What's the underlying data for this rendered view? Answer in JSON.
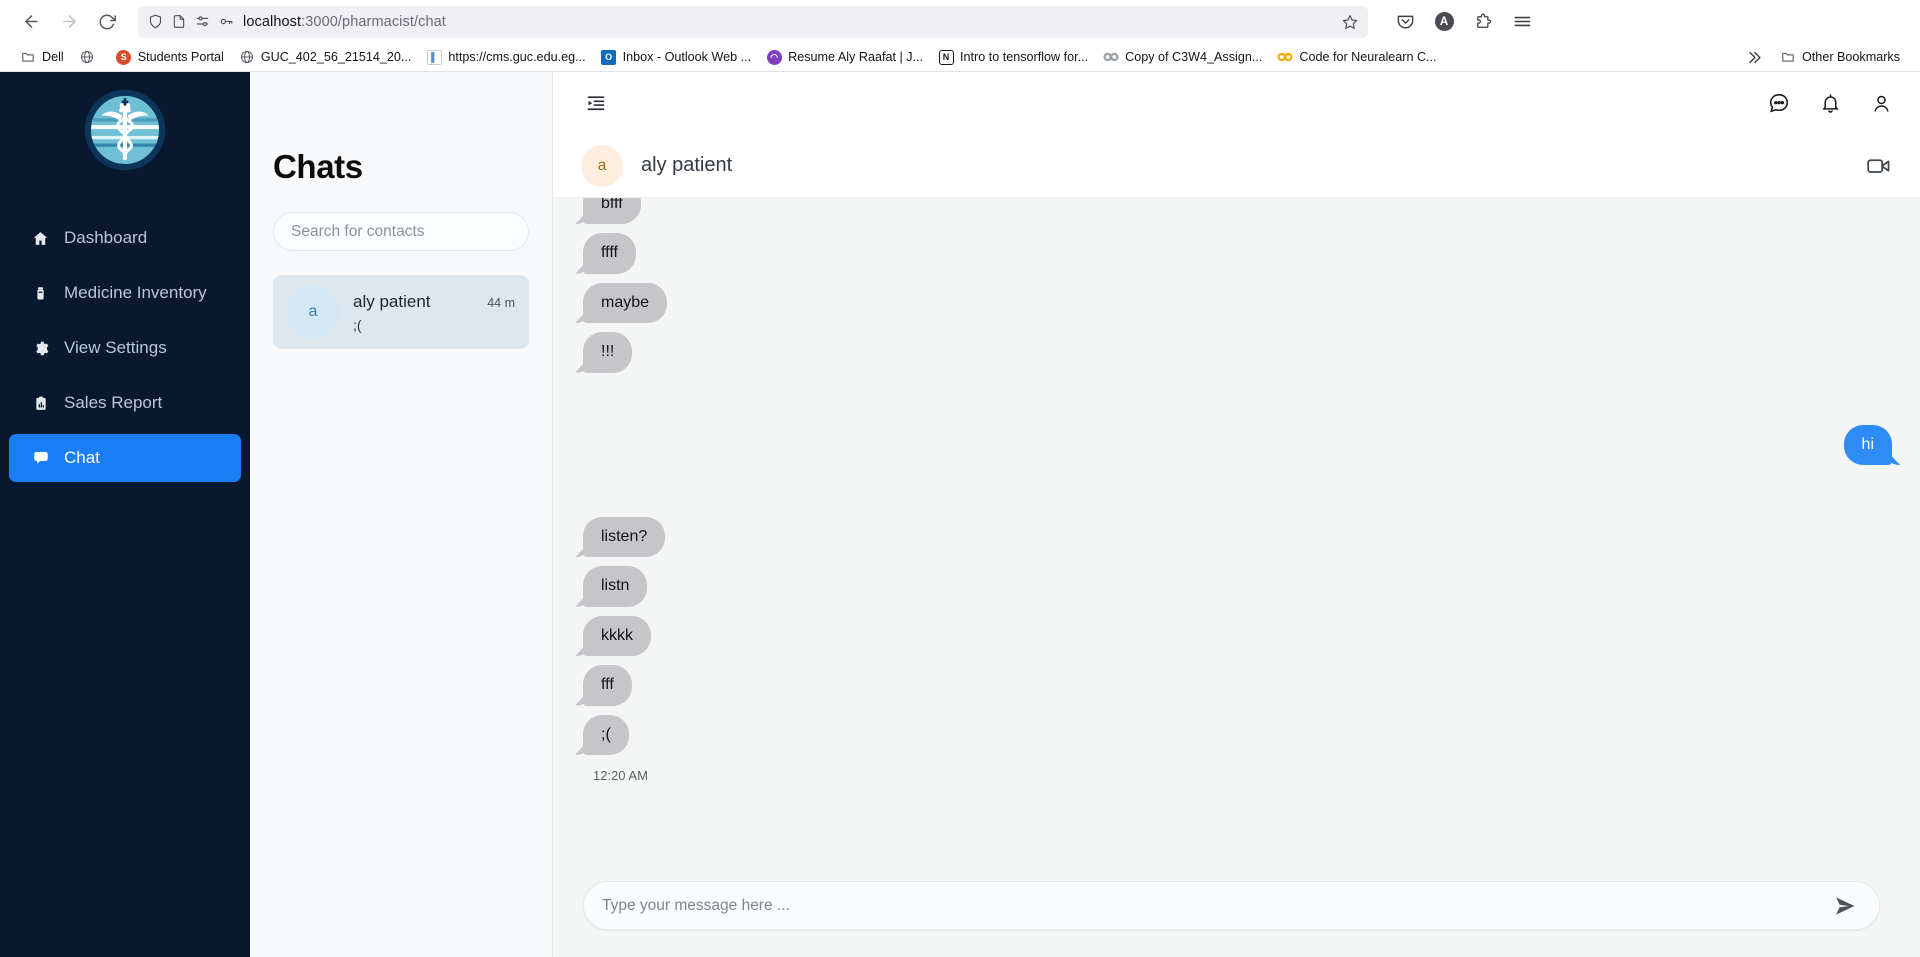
{
  "browser": {
    "nav": {
      "back_icon": "arrow-left-icon",
      "forward_icon": "arrow-right-icon",
      "reload_icon": "reload-icon"
    },
    "url": {
      "host": "localhost",
      "path": ":3000/pharmacist/chat",
      "shield_icon": "shield-icon",
      "page_icon": "page-icon",
      "permissions_icon": "permissions-icon",
      "key_icon": "key-icon",
      "bookmark_star_icon": "star-icon"
    },
    "toolbar_right": {
      "pocket_icon": "pocket-icon",
      "account_initial": "A",
      "extensions_icon": "extensions-puzzle-icon",
      "menu_icon": "hamburger-menu-icon"
    },
    "bookmarks": [
      {
        "label": "Dell",
        "icon": "folder-icon",
        "color": "#5b5b66"
      },
      {
        "label": "",
        "icon": "globe-icon",
        "color": "#5b5b66"
      },
      {
        "label": "Students Portal",
        "icon": "favicon",
        "color": "#d94c2a"
      },
      {
        "label": "GUC_402_56_21514_20...",
        "icon": "globe-icon",
        "color": "#5b5b66"
      },
      {
        "label": "https://cms.guc.edu.eg...",
        "icon": "favicon",
        "color": "#5b8cc7"
      },
      {
        "label": "Inbox - Outlook Web ...",
        "icon": "favicon",
        "color": "#0f6cbd"
      },
      {
        "label": "Resume Aly Raafat | J...",
        "icon": "favicon",
        "color": "#7f3fbf"
      },
      {
        "label": "Intro to tensorflow for...",
        "icon": "favicon",
        "color": "#1a1a1a"
      },
      {
        "label": "Copy of C3W4_Assign...",
        "icon": "favicon",
        "color": "#9aa0a6"
      },
      {
        "label": "Code for Neuralearn C...",
        "icon": "favicon",
        "color": "#f9ab00"
      }
    ],
    "overflow_icon": "chevron-double-right-icon",
    "other_bookmarks": {
      "label": "Other Bookmarks",
      "icon": "folder-icon"
    }
  },
  "sidebar": {
    "logo_name": "pharmacy-caduceus-logo",
    "active_color": "#1a7ef5",
    "background_color": "#08182e",
    "items": [
      {
        "label": "Dashboard",
        "icon": "home-icon",
        "active": false
      },
      {
        "label": "Medicine Inventory",
        "icon": "medicine-icon",
        "active": false
      },
      {
        "label": "View Settings",
        "icon": "gear-icon",
        "active": false
      },
      {
        "label": "Sales Report",
        "icon": "clipboard-icon",
        "active": false
      },
      {
        "label": "Chat",
        "icon": "chat-bubble-icon",
        "active": true
      }
    ]
  },
  "topbar": {
    "collapse_icon": "sidebar-collapse-icon",
    "icons": [
      {
        "name": "messages-icon"
      },
      {
        "name": "bell-icon"
      },
      {
        "name": "user-icon"
      }
    ]
  },
  "chats_panel": {
    "title": "Chats",
    "search": {
      "placeholder": "Search for contacts",
      "value": ""
    },
    "contacts": [
      {
        "initial": "a",
        "name": "aly patient",
        "time": "44 m",
        "preview": ";(",
        "selected": true
      }
    ]
  },
  "conversation": {
    "header": {
      "initial": "a",
      "name": "aly patient",
      "video_icon": "video-camera-icon"
    },
    "messages": [
      {
        "text": "bfff",
        "direction": "in"
      },
      {
        "text": "ffff",
        "direction": "in"
      },
      {
        "text": "maybe",
        "direction": "in"
      },
      {
        "text": "!!!",
        "direction": "in"
      },
      {
        "text": "hi",
        "direction": "out"
      },
      {
        "text": "listen?",
        "direction": "in"
      },
      {
        "text": "listn",
        "direction": "in"
      },
      {
        "text": "kkkk",
        "direction": "in"
      },
      {
        "text": "fff",
        "direction": "in"
      },
      {
        "text": ";(",
        "direction": "in"
      }
    ],
    "timestamp": "12:20 AM",
    "incoming_bubble_color": "#c6c6ca",
    "outgoing_bubble_color": "#2f8cf5"
  },
  "composer": {
    "placeholder": "Type your message here ...",
    "value": "",
    "send_icon": "send-icon"
  }
}
